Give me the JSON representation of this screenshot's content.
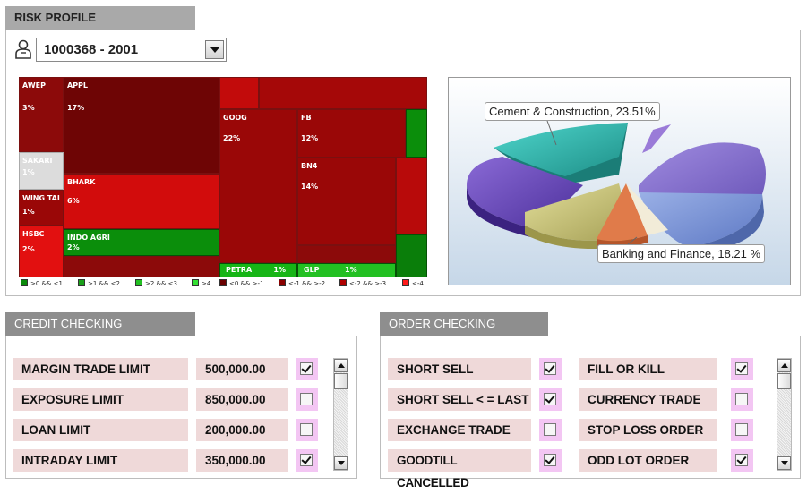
{
  "risk": {
    "title": "RISK PROFILE",
    "account": "1000368 - 2001",
    "treemap": [
      {
        "name": "AWEP",
        "pct": "3%"
      },
      {
        "name": "APPL",
        "pct": "17%"
      },
      {
        "name": "SAKARI",
        "pct": "1%"
      },
      {
        "name": "WING TAI",
        "pct": "1%"
      },
      {
        "name": "HSBC",
        "pct": "2%"
      },
      {
        "name": "BHARK",
        "pct": "6%"
      },
      {
        "name": "INDO AGRI",
        "pct": "2%"
      },
      {
        "name": "GOOG",
        "pct": "22%"
      },
      {
        "name": "FB",
        "pct": "12%"
      },
      {
        "name": "BN4",
        "pct": "14%"
      },
      {
        "name": "PETRA",
        "pct": "1%"
      },
      {
        "name": "GLP",
        "pct": "1%"
      }
    ],
    "legend": [
      {
        "label": ">0 && <1",
        "color": "#0a8a0a"
      },
      {
        "label": ">1 && <2",
        "color": "#1aa01a"
      },
      {
        "label": ">2 && <3",
        "color": "#22c022"
      },
      {
        "label": ">4",
        "color": "#33e033"
      },
      {
        "label": "<0 && >-1",
        "color": "#6a0000"
      },
      {
        "label": "<-1 && >-2",
        "color": "#8a0000"
      },
      {
        "label": "<-2 && >-3",
        "color": "#b00000"
      },
      {
        "label": "<-4",
        "color": "#ff1a1a"
      }
    ],
    "pie_callouts": {
      "top": "Cement & Construction, 23.51%",
      "bottom": "Banking and Finance, 18.21 %"
    }
  },
  "credit": {
    "title": "CREDIT CHECKING",
    "rows": [
      {
        "label": "MARGIN TRADE LIMIT",
        "value": "500,000.00",
        "checked": true
      },
      {
        "label": "EXPOSURE LIMIT",
        "value": "850,000.00",
        "checked": false
      },
      {
        "label": "LOAN LIMIT",
        "value": "200,000.00",
        "checked": false
      },
      {
        "label": "INTRADAY LIMIT",
        "value": "350,000.00",
        "checked": true
      }
    ]
  },
  "order": {
    "title": "ORDER CHECKING",
    "left": [
      {
        "label": "SHORT SELL",
        "checked": true
      },
      {
        "label": "SHORT SELL < = LAST",
        "checked": true
      },
      {
        "label": "EXCHANGE TRADE",
        "checked": false
      },
      {
        "label": "GOODTILL CANCELLED",
        "checked": true
      }
    ],
    "right": [
      {
        "label": "FILL OR KILL",
        "checked": true
      },
      {
        "label": "CURRENCY TRADE",
        "checked": false
      },
      {
        "label": "STOP LOSS ORDER",
        "checked": false
      },
      {
        "label": "ODD LOT ORDER",
        "checked": true
      }
    ]
  }
}
